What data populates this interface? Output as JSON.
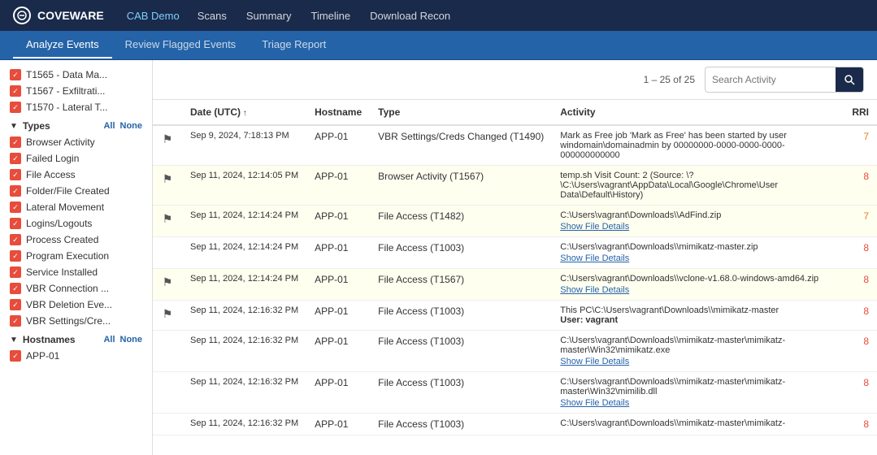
{
  "app": {
    "logo_text": "COVEWARE",
    "demo_label": "CAB Demo"
  },
  "top_nav": {
    "links": [
      "Scans",
      "Summary",
      "Timeline",
      "Download Recon"
    ]
  },
  "tabs": [
    "Analyze Events",
    "Review Flagged Events",
    "Triage Report"
  ],
  "active_tab": "Analyze Events",
  "sidebar": {
    "mitre_items": [
      {
        "label": "T1565 - Data Ma...",
        "checked": true
      },
      {
        "label": "T1567 - Exfiltrati...",
        "checked": true
      },
      {
        "label": "T1570 - Lateral T...",
        "checked": true
      }
    ],
    "types_section": "Types",
    "types_all": "All",
    "types_none": "None",
    "types": [
      {
        "label": "Browser Activity",
        "checked": true
      },
      {
        "label": "Failed Login",
        "checked": true
      },
      {
        "label": "File Access",
        "checked": true
      },
      {
        "label": "Folder/File Created",
        "checked": true
      },
      {
        "label": "Lateral Movement",
        "checked": true
      },
      {
        "label": "Logins/Logouts",
        "checked": true
      },
      {
        "label": "Process Created",
        "checked": true
      },
      {
        "label": "Program Execution",
        "checked": true
      },
      {
        "label": "Service Installed",
        "checked": true
      },
      {
        "label": "VBR Connection ...",
        "checked": true
      },
      {
        "label": "VBR Deletion Eve...",
        "checked": true
      },
      {
        "label": "VBR Settings/Cre...",
        "checked": true
      }
    ],
    "hostnames_section": "Hostnames",
    "hostnames_all": "All",
    "hostnames_none": "None",
    "hostnames": [
      {
        "label": "APP-01",
        "checked": true
      }
    ]
  },
  "toolbar": {
    "pagination": "1 – 25 of 25",
    "search_placeholder": "Search Activity",
    "search_button_icon": "🔍"
  },
  "table": {
    "columns": [
      "",
      "Date (UTC) ↑",
      "Hostname",
      "Type",
      "Activity",
      "RRI"
    ],
    "rows": [
      {
        "flagged": true,
        "highlighted": false,
        "date": "Sep 9, 2024, 7:18:13 PM",
        "hostname": "APP-01",
        "type": "VBR Settings/Creds Changed (T1490)",
        "activity": "Mark as Free job 'Mark as Free' has been started by user windomain\\domainadmin by 00000000-0000-0000-0000-000000000000",
        "show_details": "",
        "rri": "7",
        "rri_class": "rri-7"
      },
      {
        "flagged": true,
        "highlighted": true,
        "date": "Sep 11, 2024, 12:14:05 PM",
        "hostname": "APP-01",
        "type": "Browser Activity (T1567)",
        "activity": "temp.sh Visit Count: 2 (Source: \\?\\C:\\Users\\vagrant\\AppData\\Local\\Google\\Chrome\\User Data\\Default\\History)",
        "show_details": "",
        "rri": "8",
        "rri_class": "rri-8"
      },
      {
        "flagged": true,
        "highlighted": true,
        "date": "Sep 11, 2024, 12:14:24 PM",
        "hostname": "APP-01",
        "type": "File Access (T1482)",
        "activity": "C:\\Users\\vagrant\\Downloads\\\\AdFind.zip",
        "show_details": "Show File Details",
        "rri": "7",
        "rri_class": "rri-7"
      },
      {
        "flagged": false,
        "highlighted": false,
        "date": "Sep 11, 2024, 12:14:24 PM",
        "hostname": "APP-01",
        "type": "File Access (T1003)",
        "activity": "C:\\Users\\vagrant\\Downloads\\\\mimikatz-master.zip",
        "show_details": "Show File Details",
        "rri": "8",
        "rri_class": "rri-8"
      },
      {
        "flagged": true,
        "highlighted": true,
        "date": "Sep 11, 2024, 12:14:24 PM",
        "hostname": "APP-01",
        "type": "File Access (T1567)",
        "activity": "C:\\Users\\vagrant\\Downloads\\\\vclone-v1.68.0-windows-amd64.zip",
        "show_details": "Show File Details",
        "rri": "8",
        "rri_class": "rri-8"
      },
      {
        "flagged": true,
        "highlighted": false,
        "date": "Sep 11, 2024, 12:16:32 PM",
        "hostname": "APP-01",
        "type": "File Access (T1003)",
        "activity": "This PC\\C:\\Users\\vagrant\\Downloads\\\\mimikatz-master\nUser: vagrant",
        "show_details": "",
        "rri": "8",
        "rri_class": "rri-8",
        "has_user": true,
        "user_line": "User: vagrant"
      },
      {
        "flagged": false,
        "highlighted": false,
        "date": "Sep 11, 2024, 12:16:32 PM",
        "hostname": "APP-01",
        "type": "File Access (T1003)",
        "activity": "C:\\Users\\vagrant\\Downloads\\\\mimikatz-master\\mimikatz-master\\Win32\\mimikatz.exe",
        "show_details": "Show File Details",
        "rri": "8",
        "rri_class": "rri-8"
      },
      {
        "flagged": false,
        "highlighted": false,
        "date": "Sep 11, 2024, 12:16:32 PM",
        "hostname": "APP-01",
        "type": "File Access (T1003)",
        "activity": "C:\\Users\\vagrant\\Downloads\\\\mimikatz-master\\mimikatz-master\\Win32\\mimilib.dll",
        "show_details": "Show File Details",
        "rri": "8",
        "rri_class": "rri-8"
      },
      {
        "flagged": false,
        "highlighted": false,
        "date": "Sep 11, 2024, 12:16:32 PM",
        "hostname": "APP-01",
        "type": "File Access (T1003)",
        "activity": "C:\\Users\\vagrant\\Downloads\\\\mimikatz-master\\mimikatz-",
        "show_details": "",
        "rri": "8",
        "rri_class": "rri-8"
      }
    ]
  }
}
